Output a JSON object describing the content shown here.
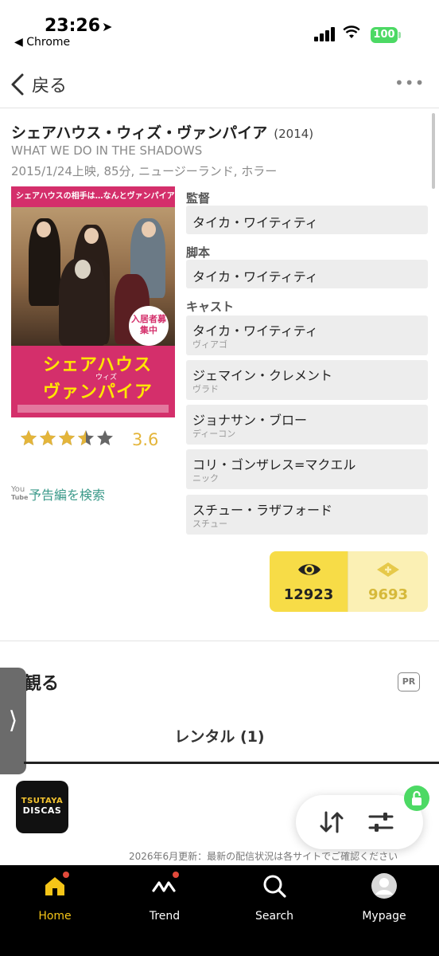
{
  "status_bar": {
    "time": "23:26",
    "back_app": "◀ Chrome",
    "battery": "100"
  },
  "nav": {
    "back_label": "戻る",
    "more_label": "•••"
  },
  "movie": {
    "title": "シェアハウス・ウィズ・ヴァンパイア",
    "year": "(2014)",
    "original_title": "WHAT WE DO IN THE SHADOWS",
    "meta": "2015/1/24上映, 85分, ニュージーランド, ホラー",
    "rating": "3.6",
    "rating_stars": 3.5,
    "trailer_label": "予告編を検索"
  },
  "poster": {
    "tagline": "シェアハウスの相手は…なんとヴァンパイア!?",
    "title_line1": "シェアハウス",
    "title_mid": "ウィズ",
    "title_line2": "ヴァンパイア",
    "badge": "入居者募集中"
  },
  "credits": {
    "director_label": "監督",
    "director": "タイカ・ワイティティ",
    "writer_label": "脚本",
    "writer": "タイカ・ワイティティ",
    "cast_label": "キャスト",
    "cast": [
      {
        "name": "タイカ・ワイティティ",
        "role": "ヴィアゴ"
      },
      {
        "name": "ジェマイン・クレメント",
        "role": "ヴラド"
      },
      {
        "name": "ジョナサン・ブロー",
        "role": "ディーコン"
      },
      {
        "name": "コリ・ゴンザレス=マクエル",
        "role": "ニック"
      },
      {
        "name": "スチュー・ラザフォード",
        "role": "スチュー"
      }
    ]
  },
  "counters": {
    "watched": "12923",
    "clipped": "9693"
  },
  "watch_section": {
    "title": "観る",
    "pr": "PR",
    "tab_rental": "レンタル (1)",
    "service_name_1": "TSUTAYA",
    "service_name_2": "DISCAS",
    "update_note": "2026年6月更新：最新の配信状況は各サイトでご確認ください"
  },
  "tabbar": {
    "home": "Home",
    "trend": "Trend",
    "search": "Search",
    "mypage": "Mypage"
  },
  "colors": {
    "accent_yellow": "#f7dc47",
    "rating_gold": "#e4b53a",
    "link_teal": "#3b9a8a",
    "tab_active": "#f5c518"
  }
}
